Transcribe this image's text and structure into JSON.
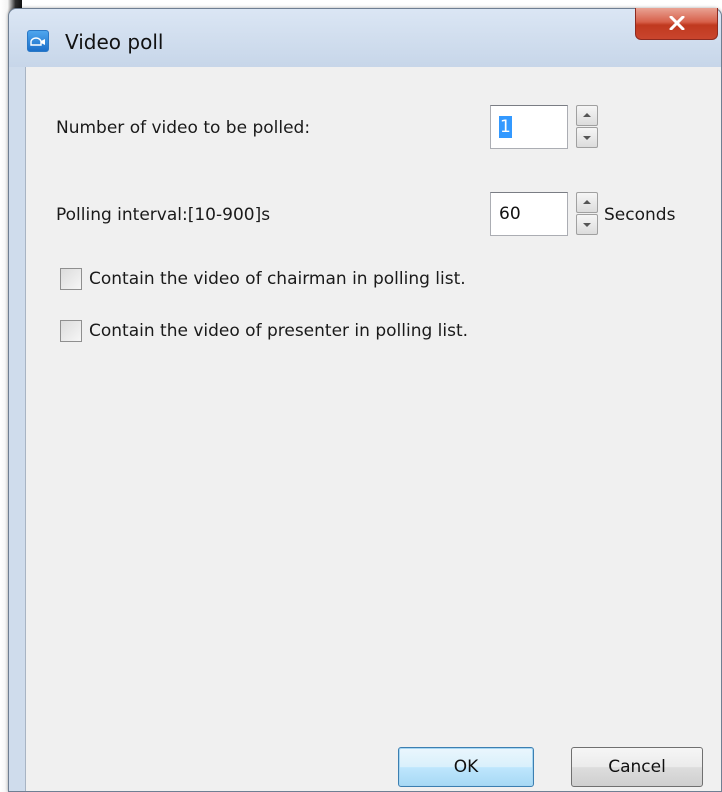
{
  "window": {
    "title": "Video poll",
    "close_label": "x"
  },
  "form": {
    "video_count": {
      "label": "Number of video to be polled:",
      "value": "1"
    },
    "interval": {
      "label": "Polling interval:[10-900]s",
      "value": "60",
      "unit": "Seconds"
    },
    "checkboxes": [
      {
        "label": "Contain the video of chairman in polling list.",
        "checked": false
      },
      {
        "label": "Contain the video of presenter in polling list.",
        "checked": false
      }
    ]
  },
  "buttons": {
    "ok": "OK",
    "cancel": "Cancel"
  },
  "icons": {
    "app": "video-camera-icon",
    "close": "close-icon",
    "spin_up": "arrow-up-icon",
    "spin_down": "arrow-down-icon"
  },
  "colors": {
    "close_button": "#c9452d",
    "selection": "#3399ff",
    "client_background": "#f0f0f0"
  }
}
